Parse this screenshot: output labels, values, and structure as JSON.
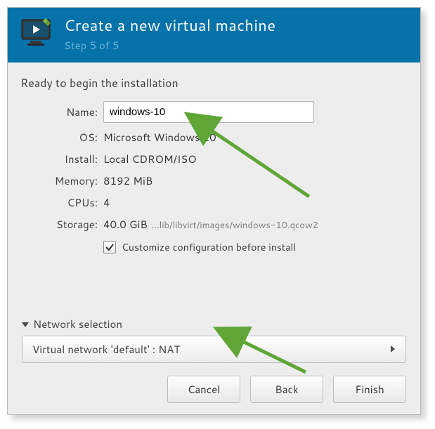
{
  "header": {
    "title": "Create a new virtual machine",
    "step": "Step 5 of 5"
  },
  "section_title": "Ready to begin the installation",
  "form": {
    "name_label": "Name:",
    "name_value": "windows-10",
    "os_label": "OS:",
    "os_value": "Microsoft Windows 10",
    "install_label": "Install:",
    "install_value": "Local CDROM/ISO",
    "memory_label": "Memory:",
    "memory_value": "8192 MiB",
    "cpus_label": "CPUs:",
    "cpus_value": "4",
    "storage_label": "Storage:",
    "storage_value": "40.0 GiB",
    "storage_path": "...lib/libvirt/images/windows-10.qcow2",
    "customize_label": "Customize configuration before install",
    "customize_checked": true
  },
  "network": {
    "expander_label": "Network selection",
    "selected": "Virtual network 'default' : NAT"
  },
  "buttons": {
    "cancel": "Cancel",
    "back": "Back",
    "finish": "Finish"
  }
}
